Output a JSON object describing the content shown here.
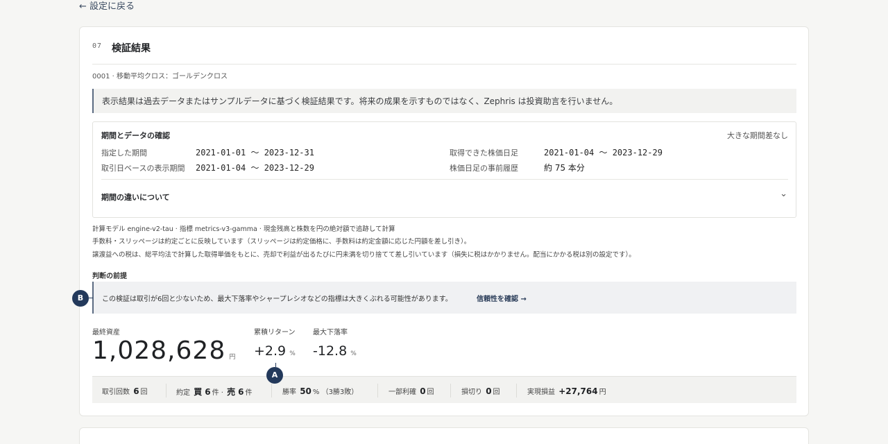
{
  "nav": {
    "back_label": "← 設定に戻る"
  },
  "section": {
    "number": "07",
    "title": "検証結果",
    "breadcrumb": "0001 · 移動平均クロス：ゴールデンクロス",
    "disclaimer": "表示結果は過去データまたはサンプルデータに基づく検証結果です。将来の成果を示すものではなく、Zephris は投資助言を行いません。"
  },
  "period_box": {
    "title": "期間とデータの確認",
    "note": "大きな期間差なし",
    "rows": [
      {
        "label": "指定した期間",
        "value": "2021-01-01 〜 2023-12-31"
      },
      {
        "label": "取引日ベースの表示期間",
        "value": "2021-01-04 〜 2023-12-29"
      },
      {
        "label": "取得できた株価日足",
        "value": "2021-01-04 〜 2023-12-29"
      },
      {
        "label": "株価日足の事前履歴",
        "value": "約 75 本分"
      }
    ],
    "accordion_label": "期間の違いについて"
  },
  "meta_lines": [
    "計算モデル engine-v2-tau · 指標 metrics-v3-gamma · 現金残高と株数を円の絶対額で追跡して計算",
    "手数料・スリッページは約定ごとに反映しています（スリッページは約定価格に、手数料は約定金額に応じた円額を差し引き）。",
    "譲渡益への税は、総平均法で計算した取得単価をもとに、売却で利益が出るたびに円未満を切り捨てて差し引いています（損失に税はかかりません。配当にかかる税は別の設定です）。"
  ],
  "premise": {
    "heading": "判断の前提",
    "text": "この検証は取引が6回と少ないため、最大下落率やシャープレシオなどの指標は大きくぶれる可能性があります。",
    "link": "信頼性を確認 →"
  },
  "markers": {
    "a": "A",
    "b": "B"
  },
  "kpis": {
    "final_label": "最終資産",
    "final_value": "1,028,628",
    "final_unit": "円",
    "return_label": "累積リターン",
    "return_value": "+2.9",
    "return_unit": "%",
    "dd_label": "最大下落率",
    "dd_value": "-12.8",
    "dd_unit": "%"
  },
  "stats": {
    "trades_label": "取引回数",
    "trades_value": "6",
    "trades_unit": "回",
    "fills_label": "約定",
    "buy_label": "買",
    "buy_value": "6",
    "buy_unit": "件 ·",
    "sell_label": "売",
    "sell_value": "6",
    "sell_unit": "件",
    "win_label": "勝率",
    "win_value": "50",
    "win_unit": "% （3勝3敗）",
    "partial_label": "一部利確",
    "partial_value": "0",
    "partial_unit": "回",
    "stop_label": "損切り",
    "stop_value": "0",
    "stop_unit": "回",
    "pnl_label": "実現損益",
    "pnl_value": "+27,764",
    "pnl_unit": "円"
  }
}
